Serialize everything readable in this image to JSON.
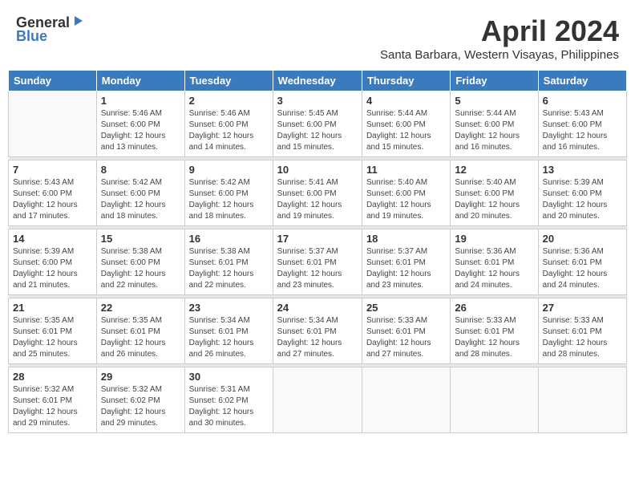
{
  "logo": {
    "general": "General",
    "blue": "Blue"
  },
  "title": "April 2024",
  "subtitle": "Santa Barbara, Western Visayas, Philippines",
  "headers": [
    "Sunday",
    "Monday",
    "Tuesday",
    "Wednesday",
    "Thursday",
    "Friday",
    "Saturday"
  ],
  "weeks": [
    [
      {
        "num": "",
        "info": ""
      },
      {
        "num": "1",
        "info": "Sunrise: 5:46 AM\nSunset: 6:00 PM\nDaylight: 12 hours\nand 13 minutes."
      },
      {
        "num": "2",
        "info": "Sunrise: 5:46 AM\nSunset: 6:00 PM\nDaylight: 12 hours\nand 14 minutes."
      },
      {
        "num": "3",
        "info": "Sunrise: 5:45 AM\nSunset: 6:00 PM\nDaylight: 12 hours\nand 15 minutes."
      },
      {
        "num": "4",
        "info": "Sunrise: 5:44 AM\nSunset: 6:00 PM\nDaylight: 12 hours\nand 15 minutes."
      },
      {
        "num": "5",
        "info": "Sunrise: 5:44 AM\nSunset: 6:00 PM\nDaylight: 12 hours\nand 16 minutes."
      },
      {
        "num": "6",
        "info": "Sunrise: 5:43 AM\nSunset: 6:00 PM\nDaylight: 12 hours\nand 16 minutes."
      }
    ],
    [
      {
        "num": "7",
        "info": "Sunrise: 5:43 AM\nSunset: 6:00 PM\nDaylight: 12 hours\nand 17 minutes."
      },
      {
        "num": "8",
        "info": "Sunrise: 5:42 AM\nSunset: 6:00 PM\nDaylight: 12 hours\nand 18 minutes."
      },
      {
        "num": "9",
        "info": "Sunrise: 5:42 AM\nSunset: 6:00 PM\nDaylight: 12 hours\nand 18 minutes."
      },
      {
        "num": "10",
        "info": "Sunrise: 5:41 AM\nSunset: 6:00 PM\nDaylight: 12 hours\nand 19 minutes."
      },
      {
        "num": "11",
        "info": "Sunrise: 5:40 AM\nSunset: 6:00 PM\nDaylight: 12 hours\nand 19 minutes."
      },
      {
        "num": "12",
        "info": "Sunrise: 5:40 AM\nSunset: 6:00 PM\nDaylight: 12 hours\nand 20 minutes."
      },
      {
        "num": "13",
        "info": "Sunrise: 5:39 AM\nSunset: 6:00 PM\nDaylight: 12 hours\nand 20 minutes."
      }
    ],
    [
      {
        "num": "14",
        "info": "Sunrise: 5:39 AM\nSunset: 6:00 PM\nDaylight: 12 hours\nand 21 minutes."
      },
      {
        "num": "15",
        "info": "Sunrise: 5:38 AM\nSunset: 6:00 PM\nDaylight: 12 hours\nand 22 minutes."
      },
      {
        "num": "16",
        "info": "Sunrise: 5:38 AM\nSunset: 6:01 PM\nDaylight: 12 hours\nand 22 minutes."
      },
      {
        "num": "17",
        "info": "Sunrise: 5:37 AM\nSunset: 6:01 PM\nDaylight: 12 hours\nand 23 minutes."
      },
      {
        "num": "18",
        "info": "Sunrise: 5:37 AM\nSunset: 6:01 PM\nDaylight: 12 hours\nand 23 minutes."
      },
      {
        "num": "19",
        "info": "Sunrise: 5:36 AM\nSunset: 6:01 PM\nDaylight: 12 hours\nand 24 minutes."
      },
      {
        "num": "20",
        "info": "Sunrise: 5:36 AM\nSunset: 6:01 PM\nDaylight: 12 hours\nand 24 minutes."
      }
    ],
    [
      {
        "num": "21",
        "info": "Sunrise: 5:35 AM\nSunset: 6:01 PM\nDaylight: 12 hours\nand 25 minutes."
      },
      {
        "num": "22",
        "info": "Sunrise: 5:35 AM\nSunset: 6:01 PM\nDaylight: 12 hours\nand 26 minutes."
      },
      {
        "num": "23",
        "info": "Sunrise: 5:34 AM\nSunset: 6:01 PM\nDaylight: 12 hours\nand 26 minutes."
      },
      {
        "num": "24",
        "info": "Sunrise: 5:34 AM\nSunset: 6:01 PM\nDaylight: 12 hours\nand 27 minutes."
      },
      {
        "num": "25",
        "info": "Sunrise: 5:33 AM\nSunset: 6:01 PM\nDaylight: 12 hours\nand 27 minutes."
      },
      {
        "num": "26",
        "info": "Sunrise: 5:33 AM\nSunset: 6:01 PM\nDaylight: 12 hours\nand 28 minutes."
      },
      {
        "num": "27",
        "info": "Sunrise: 5:33 AM\nSunset: 6:01 PM\nDaylight: 12 hours\nand 28 minutes."
      }
    ],
    [
      {
        "num": "28",
        "info": "Sunrise: 5:32 AM\nSunset: 6:01 PM\nDaylight: 12 hours\nand 29 minutes."
      },
      {
        "num": "29",
        "info": "Sunrise: 5:32 AM\nSunset: 6:02 PM\nDaylight: 12 hours\nand 29 minutes."
      },
      {
        "num": "30",
        "info": "Sunrise: 5:31 AM\nSunset: 6:02 PM\nDaylight: 12 hours\nand 30 minutes."
      },
      {
        "num": "",
        "info": ""
      },
      {
        "num": "",
        "info": ""
      },
      {
        "num": "",
        "info": ""
      },
      {
        "num": "",
        "info": ""
      }
    ]
  ]
}
